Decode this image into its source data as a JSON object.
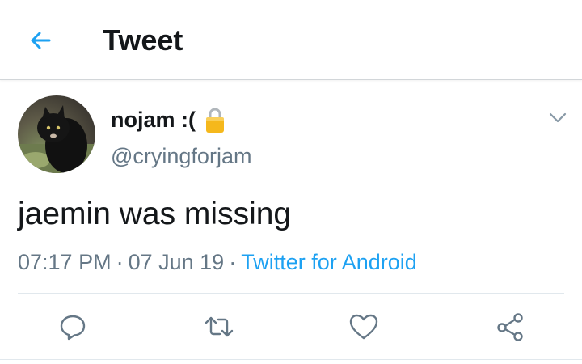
{
  "header": {
    "title": "Tweet",
    "back_icon": "arrow-left-icon"
  },
  "author": {
    "display_name": "nojam :(",
    "handle": "@cryingforjam",
    "protected_icon": "lock-icon"
  },
  "tweet": {
    "text": "jaemin was missing",
    "time": "07:17 PM",
    "date": "07 Jun 19",
    "source": "Twitter for Android"
  },
  "actions": [
    {
      "name": "reply",
      "icon": "reply-icon"
    },
    {
      "name": "retweet",
      "icon": "retweet-icon"
    },
    {
      "name": "like",
      "icon": "heart-icon"
    },
    {
      "name": "share",
      "icon": "share-icon"
    }
  ],
  "colors": {
    "accent": "#1da1f2",
    "secondary_text": "#657786",
    "primary_text": "#14171a",
    "lock": "#f4b400"
  }
}
